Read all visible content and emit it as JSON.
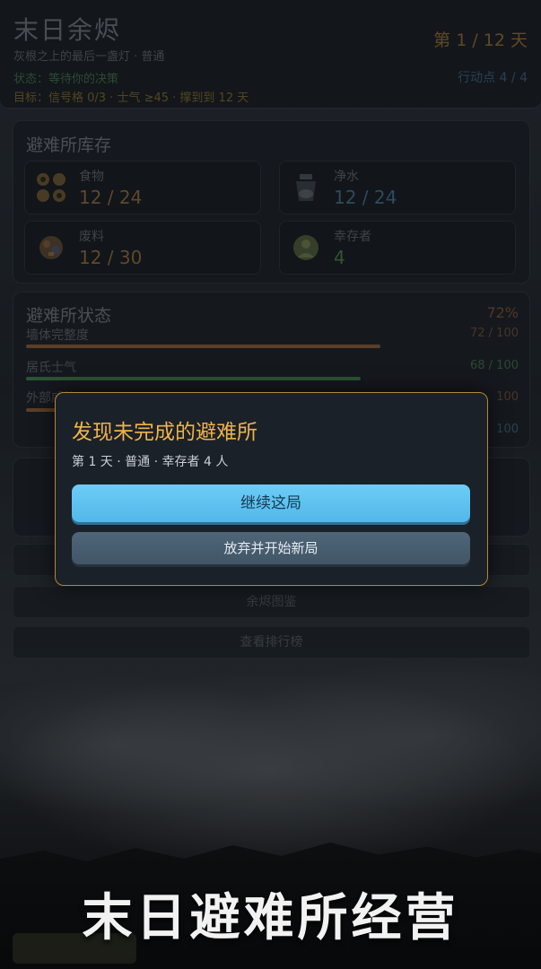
{
  "header": {
    "title": "末日余烬",
    "subtitle": "灰根之上的最后一盏灯 · 普通",
    "day_counter": "第 1 / 12 天",
    "status": "状态：等待你的决策",
    "action_points": "行动点 4 / 4",
    "goal": "目标：信号格 0/3 · 士气 ≥45 · 撑到到 12 天"
  },
  "inventory": {
    "title": "避难所库存",
    "items": [
      {
        "label": "食物",
        "value": "12 / 24",
        "icon": "food-icon",
        "color": "#8a6a3a"
      },
      {
        "label": "净水",
        "value": "12 / 24",
        "icon": "water-icon",
        "color": "#3f6d88"
      },
      {
        "label": "废料",
        "value": "12 / 30",
        "icon": "scrap-icon",
        "color": "#8a6a3a"
      },
      {
        "label": "幸存者",
        "value": "4",
        "icon": "survivor-icon",
        "color": "#4d7a45"
      }
    ]
  },
  "shelter_status": {
    "title": "避难所状态",
    "overall": "72%",
    "stats": [
      {
        "label": "墙体完整度",
        "value": "72 / 100",
        "fraction": 0.72,
        "color": "#8a5a33",
        "text_color": "#6b4b30"
      },
      {
        "label": "居氏士气",
        "value": "68 / 100",
        "fraction": 0.68,
        "color": "#3f7a48",
        "text_color": "#3c6a43"
      },
      {
        "label": "外部威胁",
        "value": "100",
        "fraction": 0.55,
        "color": "#8a5a33",
        "text_color": "#6b4b30"
      },
      {
        "label": "",
        "value": "100",
        "fraction": 0.0,
        "color": "#3a5e78",
        "text_color": "#3a5e78"
      }
    ]
  },
  "menu": {
    "codex": "余烬图鉴",
    "leaderboard": "查看排行榜"
  },
  "modal": {
    "title": "发现未完成的避难所",
    "subtitle": "第 1 天 · 普通 · 幸存者 4 人",
    "continue_label": "继续这局",
    "restart_label": "放弃并开始新局"
  },
  "banner": "末日避难所经营",
  "colors": {
    "accent_gold": "#f0b24a",
    "button_blue": "#5ec3f0",
    "modal_border": "#b68536"
  }
}
